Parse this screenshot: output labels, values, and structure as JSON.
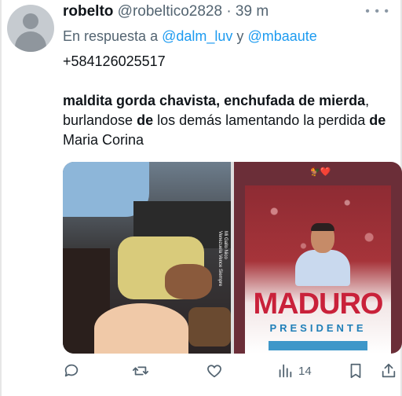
{
  "tweet": {
    "display_name": "robelto",
    "handle_time": "@robeltico2828 · 39 m",
    "reply_prefix": "En respuesta a",
    "reply_mention_1": "@dalm_luv",
    "reply_joiner": "y",
    "reply_mention_2": "@mbaaute",
    "phone": "+584126025517",
    "body": {
      "b1": "maldita gorda chavista, enchufada de mierda",
      "t1": ", burlandose ",
      "b2": "de",
      "t2": " los demás lamentando la perdida ",
      "b3": "de",
      "t3": " Maria Corina"
    }
  },
  "media": {
    "left_caption_1": "Mi Gallo Nico",
    "left_caption_2": "Venezuela Vence Siempre",
    "right_emoji": "🐓❤️",
    "poster_title": "MADURO",
    "poster_subtitle": "PRESIDENTE"
  },
  "actions": {
    "views_count": "14"
  },
  "icons": [
    "more-icon",
    "reply-icon",
    "retweet-icon",
    "like-icon",
    "views-icon",
    "bookmark-icon",
    "share-icon"
  ],
  "colors": {
    "link": "#1d9bf0",
    "secondary_text": "#536471",
    "poster_red": "#c9213a",
    "poster_blue": "#1f7fb8"
  }
}
